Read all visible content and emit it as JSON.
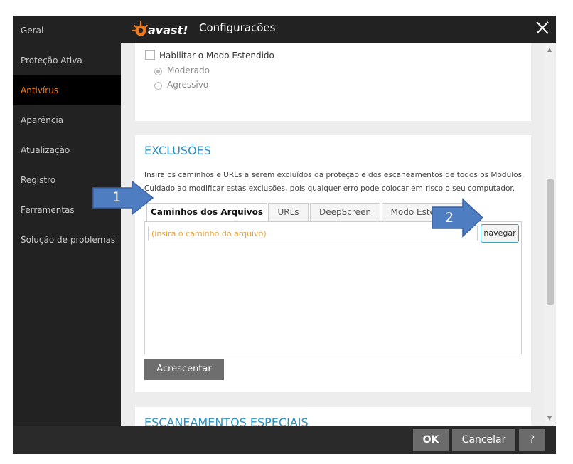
{
  "window": {
    "logo_text": "avast!",
    "title": "Configurações"
  },
  "sidebar": {
    "items": [
      {
        "label": "Geral"
      },
      {
        "label": "Proteção Ativa"
      },
      {
        "label": "Antivírus",
        "active": true
      },
      {
        "label": "Aparência"
      },
      {
        "label": "Atualização"
      },
      {
        "label": "Registro"
      },
      {
        "label": "Ferramentas"
      },
      {
        "label": "Solução de problemas"
      }
    ]
  },
  "extended_mode": {
    "checkbox_label": "Habilitar o Modo Estendido",
    "checked": false,
    "options": [
      {
        "label": "Moderado",
        "selected": true
      },
      {
        "label": "Agressivo",
        "selected": false
      }
    ]
  },
  "exclusions": {
    "title": "EXCLUSÕES",
    "description_line1": "Insira os caminhos e URLs a serem excluídos da proteção e dos escaneamentos de todos os Módulos.",
    "description_line2": "Cuidado ao modificar estas exclusões, pois qualquer erro pode colocar em risco o seu computador.",
    "tabs": [
      {
        "label": "Caminhos dos Arquivos",
        "active": true
      },
      {
        "label": "URLs"
      },
      {
        "label": "DeepScreen"
      },
      {
        "label": "Modo Estendido"
      }
    ],
    "path_input_placeholder": "(insira o caminho do arquivo)",
    "path_input_value": "",
    "browse_label": "navegar",
    "add_label": "Acrescentar"
  },
  "special_scans": {
    "title": "ESCANEAMENTOS ESPECIAIS"
  },
  "footer": {
    "ok_label": "OK",
    "cancel_label": "Cancelar",
    "help_label": "?"
  },
  "annotations": {
    "callout_1": "1",
    "callout_2": "2"
  },
  "colors": {
    "accent_orange": "#f07b1e",
    "section_title_blue": "#2a8fbd",
    "callout_blue": "#4f7dc2"
  }
}
